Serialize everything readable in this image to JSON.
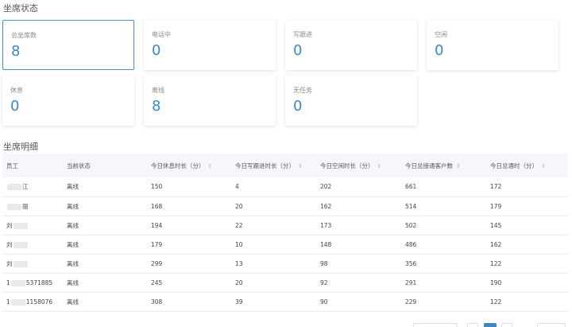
{
  "sections": {
    "status_title": "坐席状态",
    "detail_title": "坐席明细"
  },
  "cards": [
    {
      "label": "总坐席数",
      "value": "8"
    },
    {
      "label": "电话中",
      "value": "0"
    },
    {
      "label": "写跟进",
      "value": "0"
    },
    {
      "label": "空闲",
      "value": "0"
    },
    {
      "label": "休息",
      "value": "0"
    },
    {
      "label": "离线",
      "value": "8"
    },
    {
      "label": "无任务",
      "value": "0"
    }
  ],
  "table": {
    "headers": [
      "员工",
      "当前状态",
      "今日休息时长（分）",
      "今日写跟进时长（分）",
      "今日空闲时长（分）",
      "今日总接通客户数",
      "今日总通时（分）"
    ],
    "sort_icon": "⇕",
    "rows": [
      {
        "name_pre": "",
        "name_post": "江",
        "status": "离线",
        "rest": "150",
        "follow": "4",
        "idle": "202",
        "customers": "661",
        "talk": "172"
      },
      {
        "name_pre": "",
        "name_post": "丽",
        "status": "离线",
        "rest": "168",
        "follow": "20",
        "idle": "162",
        "customers": "514",
        "talk": "179"
      },
      {
        "name_pre": "刘",
        "name_post": "",
        "status": "离线",
        "rest": "194",
        "follow": "22",
        "idle": "173",
        "customers": "502",
        "talk": "145"
      },
      {
        "name_pre": "刘",
        "name_post": "",
        "status": "离线",
        "rest": "179",
        "follow": "10",
        "idle": "148",
        "customers": "486",
        "talk": "162"
      },
      {
        "name_pre": "刘",
        "name_post": "",
        "status": "离线",
        "rest": "299",
        "follow": "13",
        "idle": "98",
        "customers": "356",
        "talk": "122"
      },
      {
        "name_pre": "1",
        "name_post": "5371885",
        "status": "离线",
        "rest": "245",
        "follow": "20",
        "idle": "92",
        "customers": "291",
        "talk": "190"
      },
      {
        "name_pre": "1",
        "name_post": "1158076",
        "status": "离线",
        "rest": "308",
        "follow": "39",
        "idle": "90",
        "customers": "229",
        "talk": "122"
      }
    ]
  },
  "colors": {
    "accent": "#3f87c4"
  }
}
